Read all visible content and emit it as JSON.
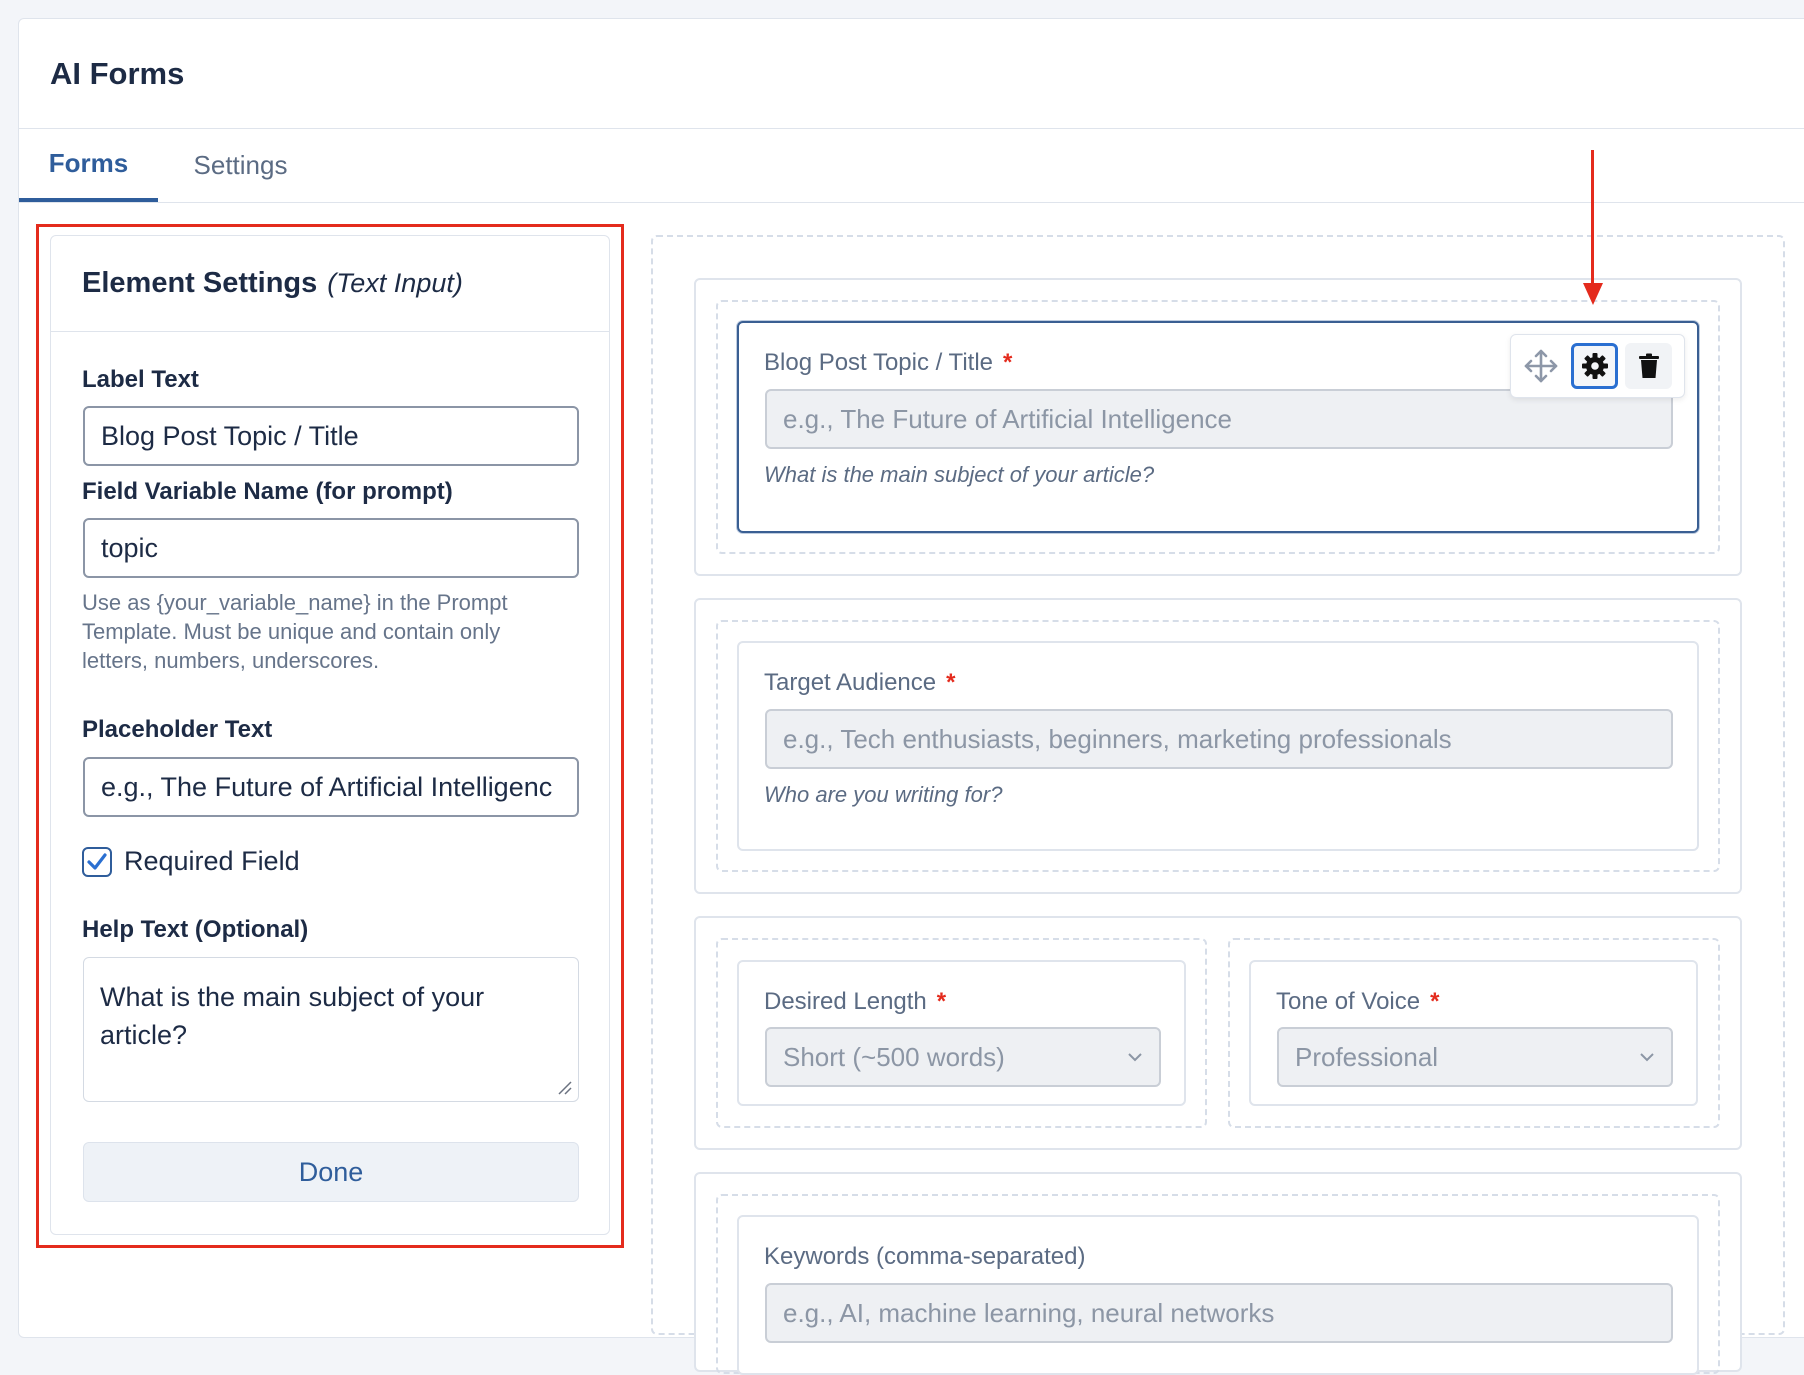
{
  "app": {
    "title": "AI Forms"
  },
  "tabs": [
    {
      "label": "Forms",
      "active": true
    },
    {
      "label": "Settings",
      "active": false
    }
  ],
  "element_settings": {
    "title": "Element Settings",
    "subtitle": "(Text Input)",
    "label_text": {
      "label": "Label Text",
      "value": "Blog Post Topic / Title"
    },
    "variable_name": {
      "label": "Field Variable Name (for prompt)",
      "value": "topic",
      "hint": "Use as {your_variable_name} in the Prompt Template. Must be unique and contain only letters, numbers, underscores."
    },
    "placeholder_text": {
      "label": "Placeholder Text",
      "value": "e.g., The Future of Artificial Intelligenc"
    },
    "required": {
      "label": "Required Field",
      "checked": true
    },
    "help_text": {
      "label": "Help Text (Optional)",
      "value": "What is the main subject of your article?"
    },
    "done_label": "Done"
  },
  "form_fields": {
    "topic": {
      "label": "Blog Post Topic / Title",
      "required_mark": "*",
      "placeholder": "e.g., The Future of Artificial Intelligence",
      "help": "What is the main subject of your article?"
    },
    "audience": {
      "label": "Target Audience",
      "required_mark": "*",
      "placeholder": "e.g., Tech enthusiasts, beginners, marketing professionals",
      "help": "Who are you writing for?"
    },
    "length": {
      "label": "Desired Length",
      "required_mark": "*",
      "selected": "Short (~500 words)"
    },
    "tone": {
      "label": "Tone of Voice",
      "required_mark": "*",
      "selected": "Professional"
    },
    "keywords": {
      "label": "Keywords (comma-separated)",
      "placeholder": "e.g., AI, machine learning, neural networks"
    }
  },
  "toolbar": {
    "icons": [
      "move-icon",
      "gear-icon",
      "trash-icon"
    ]
  },
  "colors": {
    "accent": "#2f5d9b",
    "highlight": "#e42b1d",
    "selected_border": "#3a5f93"
  }
}
